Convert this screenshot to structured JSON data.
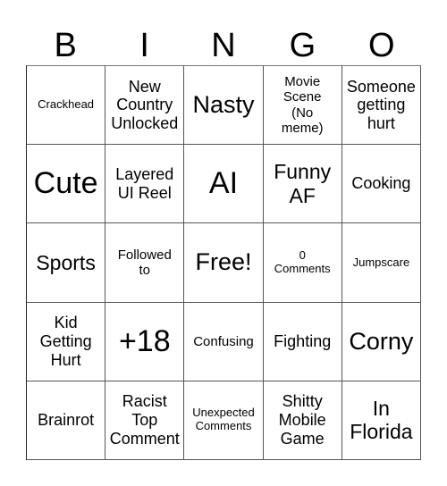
{
  "header": {
    "letters": [
      "B",
      "I",
      "N",
      "G",
      "O"
    ]
  },
  "board": {
    "rows": [
      [
        {
          "text": "Crackhead",
          "size": "xs"
        },
        {
          "text": "New\nCountry\nUnlocked",
          "size": "m"
        },
        {
          "text": "Nasty",
          "size": "xl"
        },
        {
          "text": "Movie\nScene\n(No\nmeme)",
          "size": "s"
        },
        {
          "text": "Someone\ngetting\nhurt",
          "size": "m"
        }
      ],
      [
        {
          "text": "Cute",
          "size": "xxl"
        },
        {
          "text": "Layered\nUI Reel",
          "size": "m"
        },
        {
          "text": "AI",
          "size": "xxl"
        },
        {
          "text": "Funny\nAF",
          "size": "l"
        },
        {
          "text": "Cooking",
          "size": "m"
        }
      ],
      [
        {
          "text": "Sports",
          "size": "l"
        },
        {
          "text": "Followed\nto",
          "size": "s"
        },
        {
          "text": "Free!",
          "size": "xl"
        },
        {
          "text": "0\nComments",
          "size": "xs"
        },
        {
          "text": "Jumpscare",
          "size": "xs"
        }
      ],
      [
        {
          "text": "Kid\nGetting\nHurt",
          "size": "m"
        },
        {
          "text": "+18",
          "size": "xxl"
        },
        {
          "text": "Confusing",
          "size": "s"
        },
        {
          "text": "Fighting",
          "size": "m"
        },
        {
          "text": "Corny",
          "size": "xl"
        }
      ],
      [
        {
          "text": "Brainrot",
          "size": "m"
        },
        {
          "text": "Racist\nTop\nComment",
          "size": "m"
        },
        {
          "text": "Unexpected\nComments",
          "size": "xs"
        },
        {
          "text": "Shitty\nMobile\nGame",
          "size": "m"
        },
        {
          "text": "In\nFlorida",
          "size": "l"
        }
      ]
    ]
  }
}
